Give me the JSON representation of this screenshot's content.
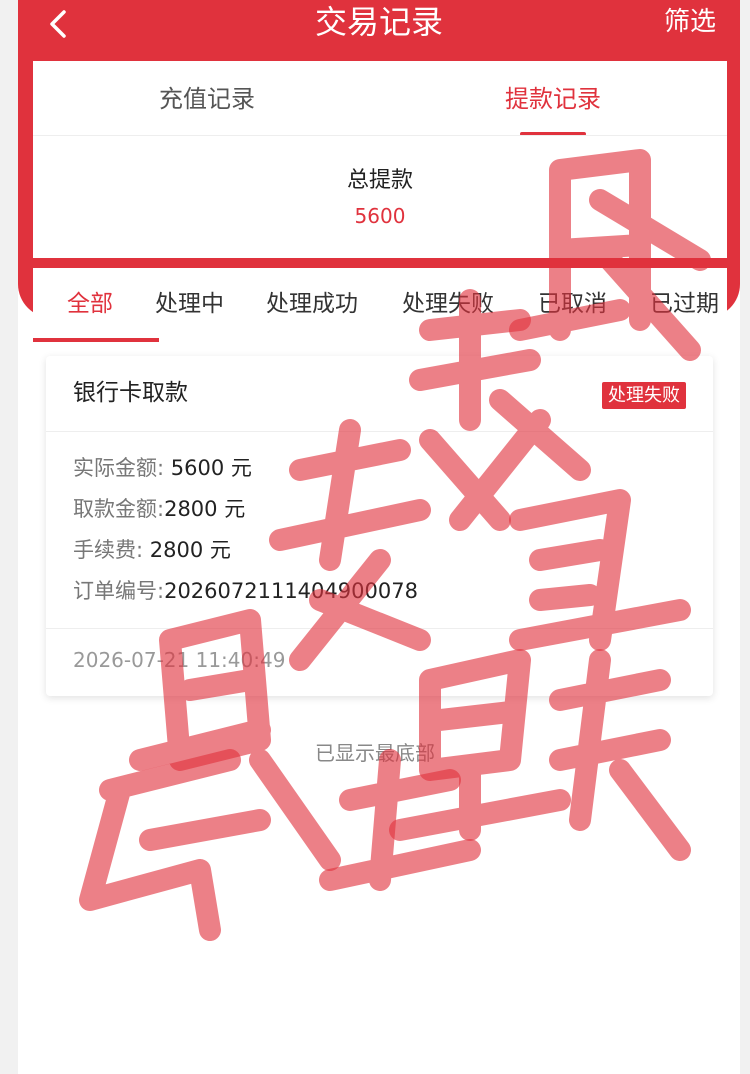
{
  "header": {
    "title": "交易记录",
    "filter_label": "筛选"
  },
  "tabs": [
    {
      "label": "充值记录",
      "active": false
    },
    {
      "label": "提款记录",
      "active": true
    }
  ],
  "summary": {
    "total_label": "总提款",
    "total_value": "5600"
  },
  "status_tabs": [
    {
      "label": "全部",
      "active": true
    },
    {
      "label": "处理中",
      "active": false
    },
    {
      "label": "处理成功",
      "active": false
    },
    {
      "label": "处理失败",
      "active": false
    },
    {
      "label": "已取消",
      "active": false
    },
    {
      "label": "已过期",
      "active": false
    }
  ],
  "record": {
    "title": "银行卡取款",
    "status": "处理失败",
    "fields": [
      {
        "key": "实际金额:",
        "value": " 5600 元"
      },
      {
        "key": "取款金额:",
        "value": "2800 元"
      },
      {
        "key": "手续费:",
        "value": " 2800 元"
      },
      {
        "key": "订单编号:",
        "value": "2026072111404900078"
      }
    ],
    "time": "2026-07-21 11:40:49"
  },
  "footer_note": "已显示最底部",
  "watermark": {
    "text": "账号异常骗局账号已关联骗",
    "color": "#e0323d"
  },
  "colors": {
    "accent": "#e0323d",
    "text_primary": "#222222",
    "text_secondary": "#777777"
  },
  "icons": {
    "back": "chevron-left-icon"
  }
}
